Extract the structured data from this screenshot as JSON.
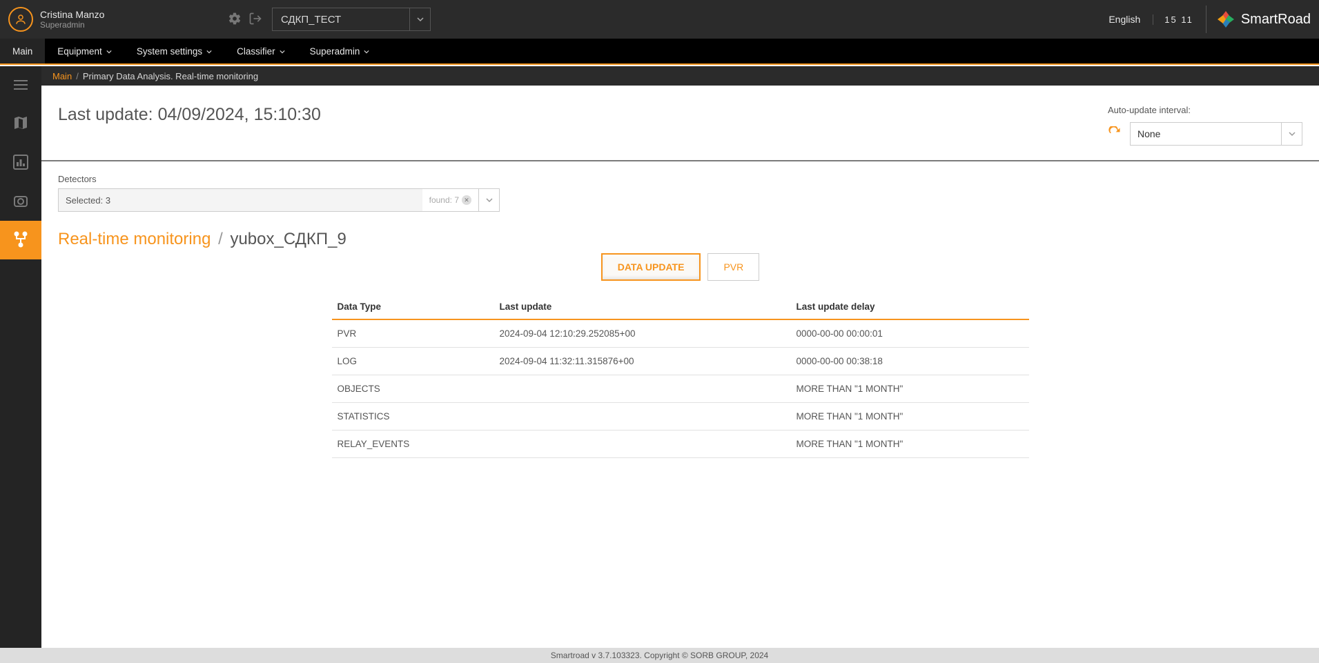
{
  "header": {
    "user_name": "Cristina Manzo",
    "user_role": "Superadmin",
    "project": "СДКП_ТЕСТ",
    "language": "English",
    "clock": "15 11",
    "brand": "SmartRoad"
  },
  "nav": {
    "items": [
      {
        "label": "Main",
        "active": true,
        "dropdown": false
      },
      {
        "label": "Equipment",
        "active": false,
        "dropdown": true
      },
      {
        "label": "System settings",
        "active": false,
        "dropdown": true
      },
      {
        "label": "Classifier",
        "active": false,
        "dropdown": true
      },
      {
        "label": "Superadmin",
        "active": false,
        "dropdown": true
      }
    ]
  },
  "breadcrumb": {
    "main": "Main",
    "rest": "Primary Data Analysis. Real-time monitoring"
  },
  "content": {
    "last_update_prefix": "Last update: ",
    "last_update_value": "04/09/2024, 15:10:30",
    "auto_update_label": "Auto-update interval:",
    "auto_update_value": "None",
    "detectors_label": "Detectors",
    "detectors_selected": "Selected: 3",
    "detectors_found": "found: 7",
    "section": {
      "rt": "Real-time monitoring",
      "sep": "/",
      "name": "yubox_СДКП_9"
    },
    "tabs": {
      "data_update": "DATA UPDATE",
      "pvr": "PVR"
    },
    "table": {
      "headers": {
        "type": "Data Type",
        "last": "Last update",
        "delay": "Last update delay"
      },
      "rows": [
        {
          "type": "PVR",
          "last": "2024-09-04 12:10:29.252085+00",
          "delay": "0000-00-00 00:00:01"
        },
        {
          "type": "LOG",
          "last": "2024-09-04 11:32:11.315876+00",
          "delay": "0000-00-00 00:38:18"
        },
        {
          "type": "OBJECTS",
          "last": "",
          "delay": "MORE THAN \"1 MONTH\""
        },
        {
          "type": "STATISTICS",
          "last": "",
          "delay": "MORE THAN \"1 MONTH\""
        },
        {
          "type": "RELAY_EVENTS",
          "last": "",
          "delay": "MORE THAN \"1 MONTH\""
        }
      ]
    }
  },
  "footer": "Smartroad v 3.7.103323. Copyright © SORB GROUP, 2024"
}
